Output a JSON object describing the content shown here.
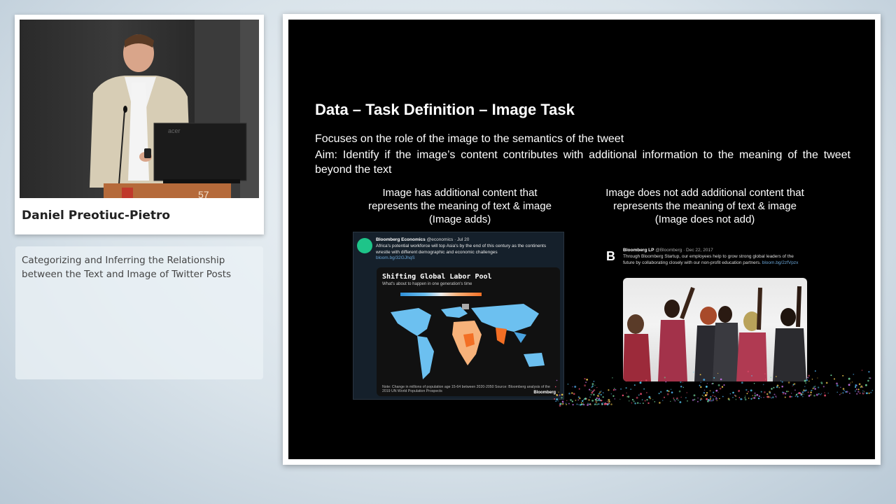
{
  "speaker": {
    "name": "Daniel Preotiuc-Pietro"
  },
  "talk": {
    "title": "Categorizing and Inferring the Relationship between the Text and Image of Twitter Posts"
  },
  "slide": {
    "title": "Data – Task Definition – Image Task",
    "line1": "Focuses on the role of the image to the semantics of the tweet",
    "line2": "Aim: Identify if the image’s content contributes with additional information to the meaning of the tweet beyond the text",
    "left_caption": [
      "Image has additional content that",
      "represents the meaning of text & image",
      "(Image adds)"
    ],
    "right_caption": [
      "Image does not add additional content that",
      "represents the meaning of text & image",
      "(Image does not add)"
    ]
  },
  "tweet_left": {
    "account": "Bloomberg Economics",
    "handle_date": "@economics · Jul 20",
    "text": "Africa's potential workforce will top Asia's by the end of this century as the continents wrestle with different demographic and economic challenges",
    "link": "bloom.bg/32GJhqS",
    "map_title": "Shifting Global Labor Pool",
    "map_subtitle": "What's about to happen in one generation's time",
    "map_note": "Note: Change in millions of population age 15-64 between 2020-2050 Source: Bloomberg analysis of the 2019 UN World Population Prospects",
    "brand": "Bloomberg"
  },
  "tweet_right": {
    "logo": "B",
    "account": "Bloomberg LP",
    "handle_date": "@Bloomberg · Dec 22, 2017",
    "text": "Through Bloomberg Startup, our employees help to grow strong global leaders of the future by collaborating closely with our non-profit education partners.",
    "link": "bloom.bg/2zfVpzx"
  },
  "colors": {
    "slide_bg": "#000000",
    "accent_green": "#1ec489",
    "link_blue": "#6aa5d6"
  }
}
